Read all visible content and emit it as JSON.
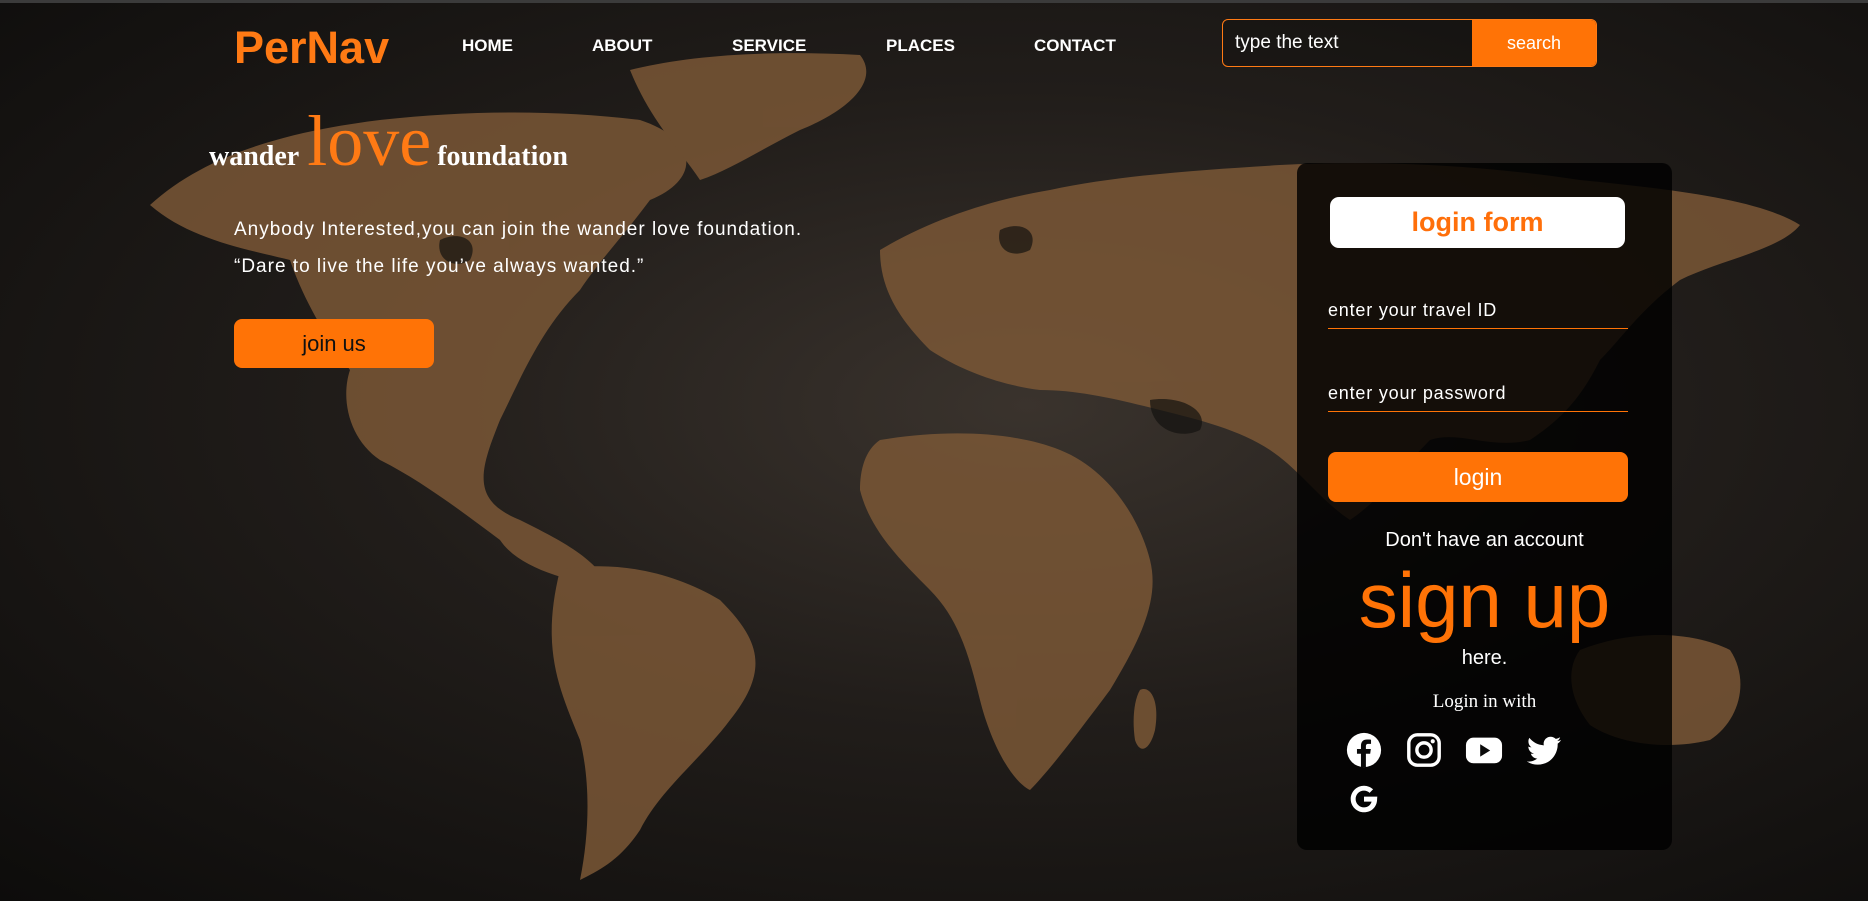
{
  "brand": {
    "logo": "PerNav",
    "accent_color": "#ff7306"
  },
  "nav": {
    "items": [
      {
        "label": "HOME"
      },
      {
        "label": "ABOUT"
      },
      {
        "label": "SERVICE"
      },
      {
        "label": "PLACES"
      },
      {
        "label": "CONTACT"
      }
    ]
  },
  "search": {
    "placeholder": "type the text",
    "button_label": "search"
  },
  "hero": {
    "title_prefix": "wander",
    "title_main": "love",
    "title_suffix": "foundation",
    "line1": "Anybody Interested,you can join the wander love foundation.",
    "line2": "“Dare to live the life you’ve always wanted.”",
    "join_label": "join us"
  },
  "login": {
    "title": "login form",
    "travel_id_placeholder": "enter your travel ID",
    "password_placeholder": "enter your password",
    "button_label": "login",
    "no_account": "Don't have an account",
    "signup": "sign up",
    "here": "here.",
    "login_with": "Login in with",
    "socials": [
      "facebook-icon",
      "instagram-icon",
      "youtube-icon",
      "twitter-icon",
      "google-icon"
    ]
  }
}
